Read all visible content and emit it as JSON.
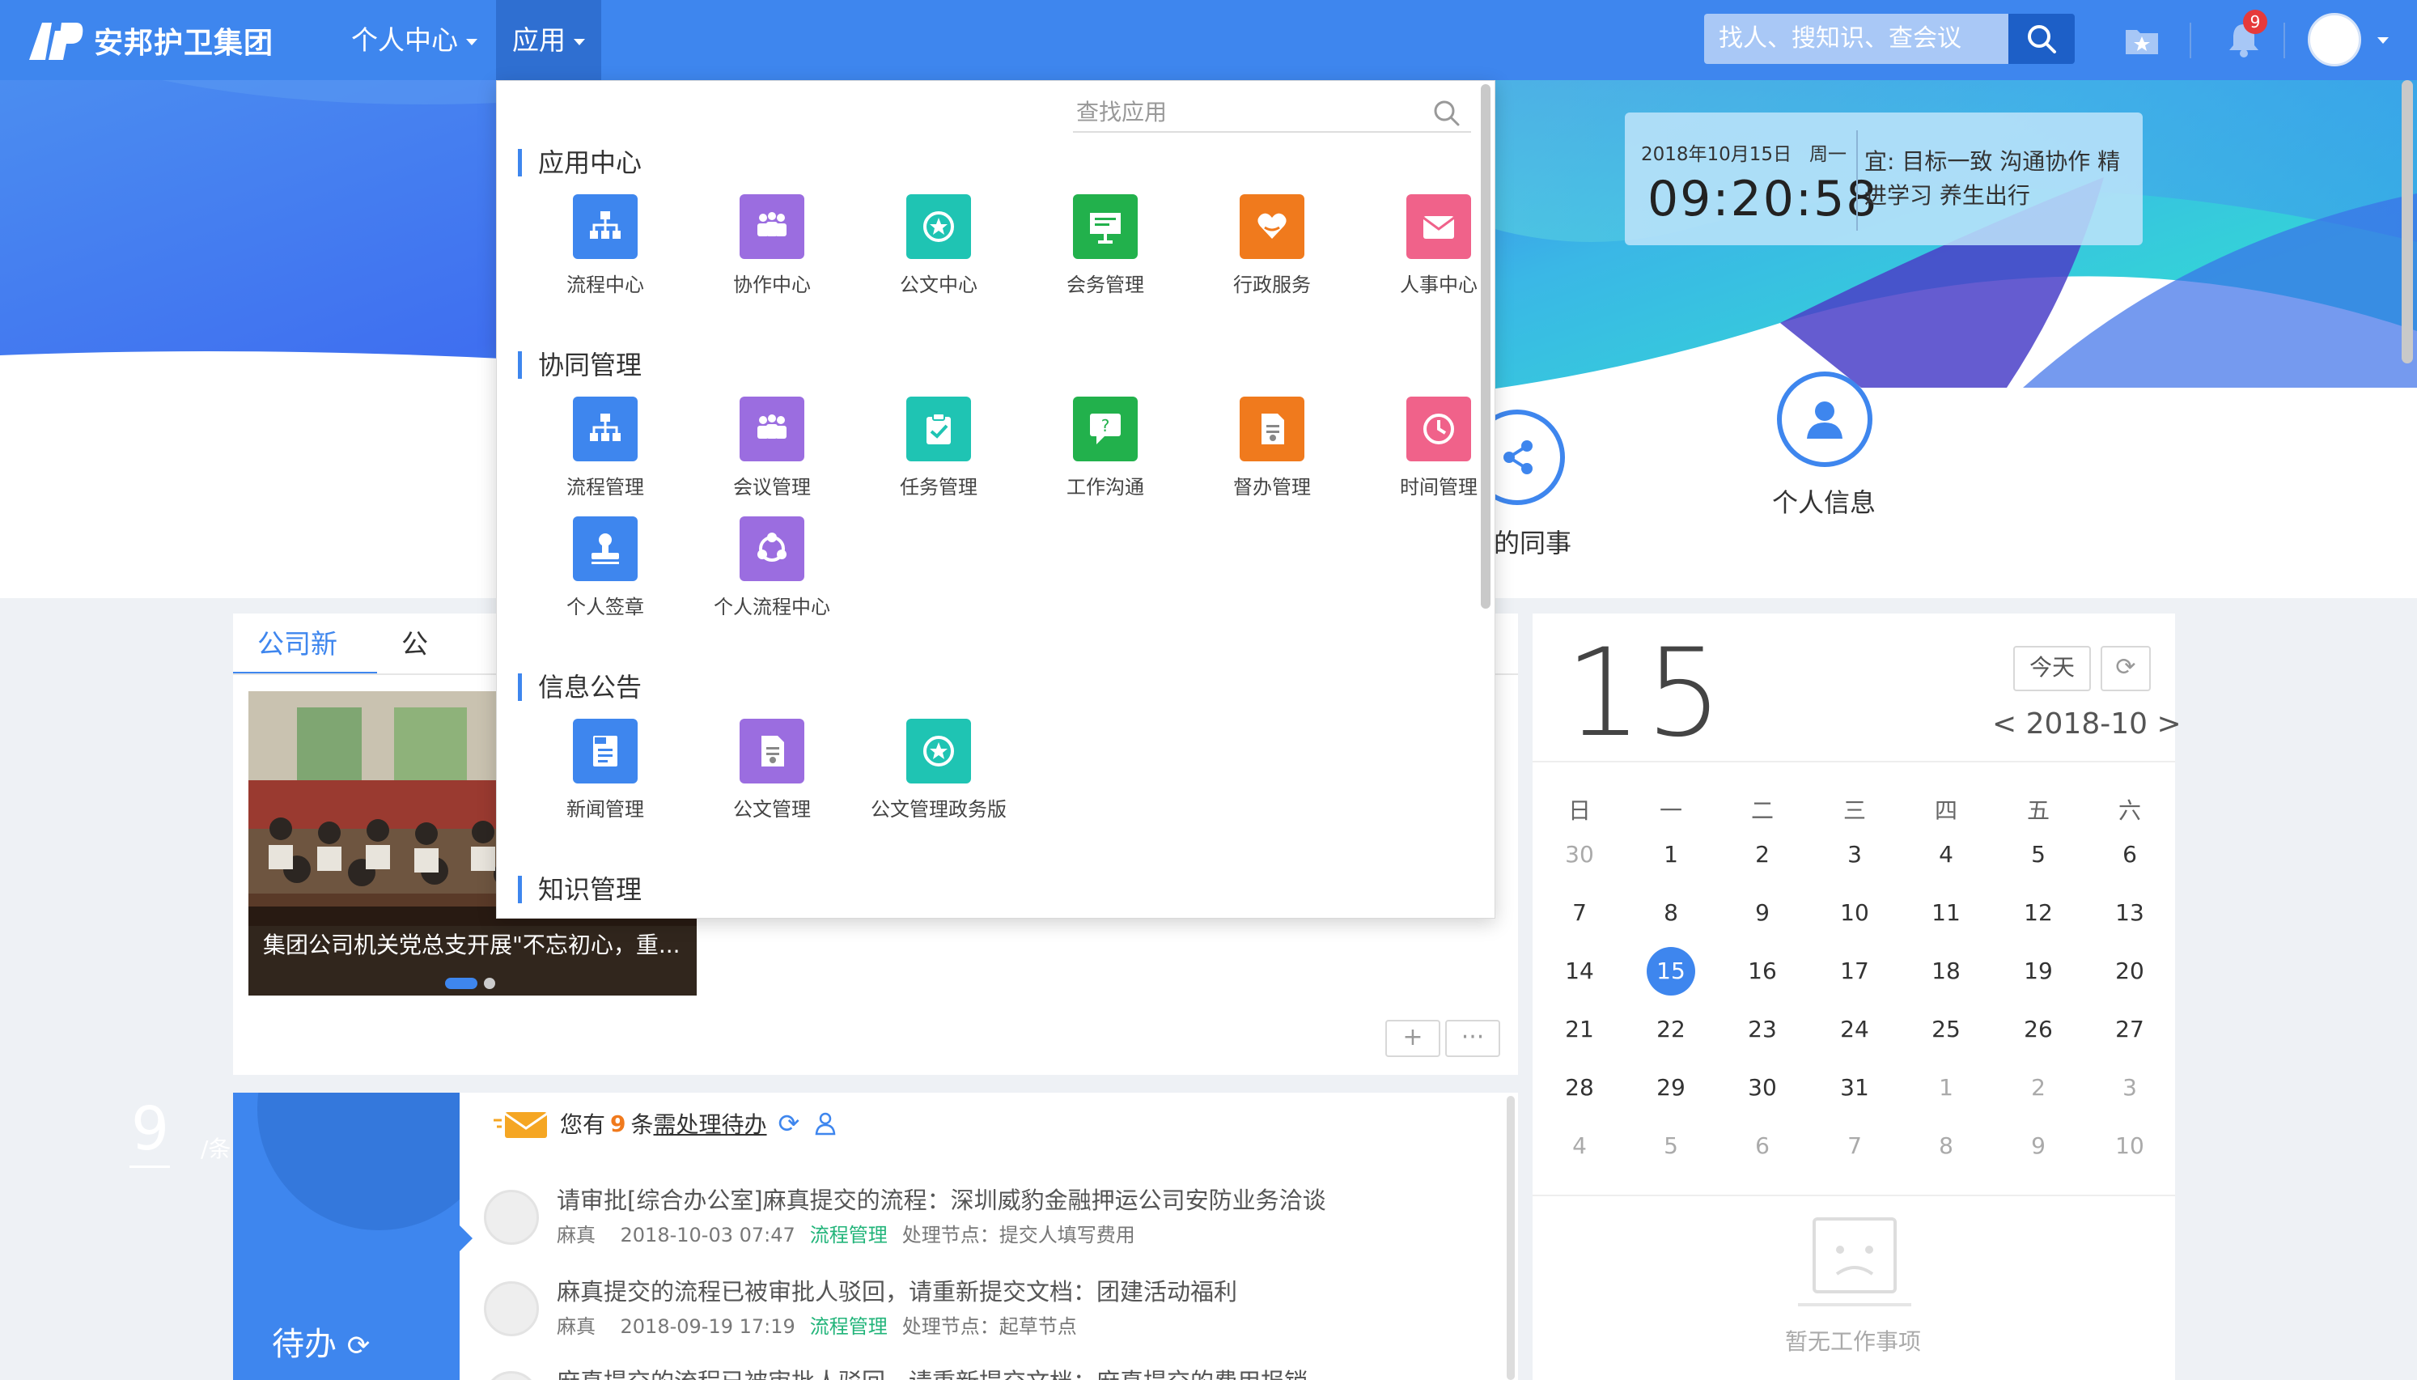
{
  "brand": {
    "name": "安邦护卫集团"
  },
  "nav": {
    "personal": "个人中心",
    "apps": "应用"
  },
  "search": {
    "placeholder": "找人、搜知识、查会议"
  },
  "notifications": {
    "count": "9"
  },
  "clock": {
    "date": "2018年10月15日",
    "weekday": "周一",
    "time": "09:20:58",
    "yi": "宜: 目标一致 沟通协作 精进学习 养生出行"
  },
  "banner": {
    "colleagues_label": "的同事",
    "personal_info_label": "个人信息"
  },
  "news": {
    "tabs": [
      "公司新闻",
      "公司公告"
    ],
    "caption": "集团公司机关党总支开展\"不忘初心，重..."
  },
  "todo": {
    "count": "9",
    "unit": "/条",
    "label": "待办",
    "header_prefix": "您有",
    "header_count": "9",
    "header_mid": "条",
    "header_link": "需处理待办",
    "items": [
      {
        "title": "请审批[综合办公室]麻真提交的流程：深圳威豹金融押运公司安防业务洽谈",
        "user": "麻真",
        "time": "2018-10-03 07:47",
        "module": "流程管理",
        "node": "处理节点：提交人填写费用"
      },
      {
        "title": "麻真提交的流程已被审批人驳回，请重新提交文档：团建活动福利",
        "user": "麻真",
        "time": "2018-09-19 17:19",
        "module": "流程管理",
        "node": "处理节点：起草节点"
      },
      {
        "title": "麻真提交的流程已被审批人驳回，请重新提交文档：麻真提交的费用报销",
        "user": "",
        "time": "",
        "module": "",
        "node": ""
      }
    ]
  },
  "calendar": {
    "big_day": "15",
    "today_btn": "今天",
    "month": "< 2018-10 >",
    "weekdays": [
      "日",
      "一",
      "二",
      "三",
      "四",
      "五",
      "六"
    ],
    "weeks": [
      [
        "30",
        "1",
        "2",
        "3",
        "4",
        "5",
        "6"
      ],
      [
        "7",
        "8",
        "9",
        "10",
        "11",
        "12",
        "13"
      ],
      [
        "14",
        "15",
        "16",
        "17",
        "18",
        "19",
        "20"
      ],
      [
        "21",
        "22",
        "23",
        "24",
        "25",
        "26",
        "27"
      ],
      [
        "28",
        "29",
        "30",
        "31",
        "1",
        "2",
        "3"
      ],
      [
        "4",
        "5",
        "6",
        "7",
        "8",
        "9",
        "10"
      ]
    ],
    "today": "15",
    "empty_text": "暂无工作事项"
  },
  "dropdown": {
    "search_placeholder": "查找应用",
    "sections": [
      {
        "title": "应用中心",
        "apps": [
          {
            "label": "流程中心",
            "icon": "org-chart-icon",
            "color": "#3e86ee"
          },
          {
            "label": "协作中心",
            "icon": "group-icon",
            "color": "#9b6de0"
          },
          {
            "label": "公文中心",
            "icon": "star-badge-icon",
            "color": "#1fc4b3"
          },
          {
            "label": "会务管理",
            "icon": "presentation-icon",
            "color": "#22b14c"
          },
          {
            "label": "行政服务",
            "icon": "heart-hand-icon",
            "color": "#f07a1d"
          },
          {
            "label": "人事中心",
            "icon": "mail-icon",
            "color": "#f0628a"
          }
        ]
      },
      {
        "title": "协同管理",
        "apps": [
          {
            "label": "流程管理",
            "icon": "org-chart-icon",
            "color": "#3e86ee"
          },
          {
            "label": "会议管理",
            "icon": "group-icon",
            "color": "#9b6de0"
          },
          {
            "label": "任务管理",
            "icon": "clipboard-check-icon",
            "color": "#1fc4b3"
          },
          {
            "label": "工作沟通",
            "icon": "chat-question-icon",
            "color": "#22b14c"
          },
          {
            "label": "督办管理",
            "icon": "document-icon",
            "color": "#f07a1d"
          },
          {
            "label": "时间管理",
            "icon": "clock-icon",
            "color": "#f0628a"
          },
          {
            "label": "个人签章",
            "icon": "stamp-icon",
            "color": "#3e86ee"
          },
          {
            "label": "个人流程中心",
            "icon": "cycle-icon",
            "color": "#9b6de0"
          }
        ]
      },
      {
        "title": "信息公告",
        "apps": [
          {
            "label": "新闻管理",
            "icon": "news-icon",
            "color": "#3e86ee"
          },
          {
            "label": "公文管理",
            "icon": "document-icon",
            "color": "#9b6de0"
          },
          {
            "label": "公文管理政务版",
            "icon": "star-badge-icon",
            "color": "#1fc4b3"
          }
        ]
      },
      {
        "title": "知识管理",
        "apps": [
          {
            "label": "",
            "icon": "app-icon",
            "color": "#3e86ee"
          },
          {
            "label": "",
            "icon": "app-icon",
            "color": "#9b6de0"
          },
          {
            "label": "",
            "icon": "app-icon",
            "color": "#1fc4b3"
          },
          {
            "label": "",
            "icon": "app-icon",
            "color": "#22b14c"
          },
          {
            "label": "",
            "icon": "app-icon",
            "color": "#f07a1d"
          },
          {
            "label": "",
            "icon": "app-icon",
            "color": "#f0628a"
          }
        ]
      }
    ]
  }
}
